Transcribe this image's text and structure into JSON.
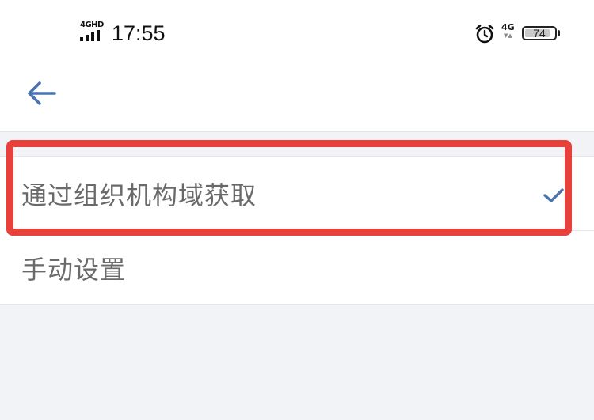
{
  "status_bar": {
    "network_label": "4GHD",
    "time": "17:55",
    "alarm_icon": "alarm-icon",
    "network_type": "4G",
    "battery_level": "74"
  },
  "header": {
    "back_icon": "arrow-left-icon"
  },
  "options": [
    {
      "label": "通过组织机构域获取",
      "selected": true
    },
    {
      "label": "手动设置",
      "selected": false
    }
  ],
  "colors": {
    "accent": "#4a74b0",
    "annotation": "#e8403a",
    "page_background": "#f1f3f6",
    "item_text": "#6a6a6a"
  }
}
